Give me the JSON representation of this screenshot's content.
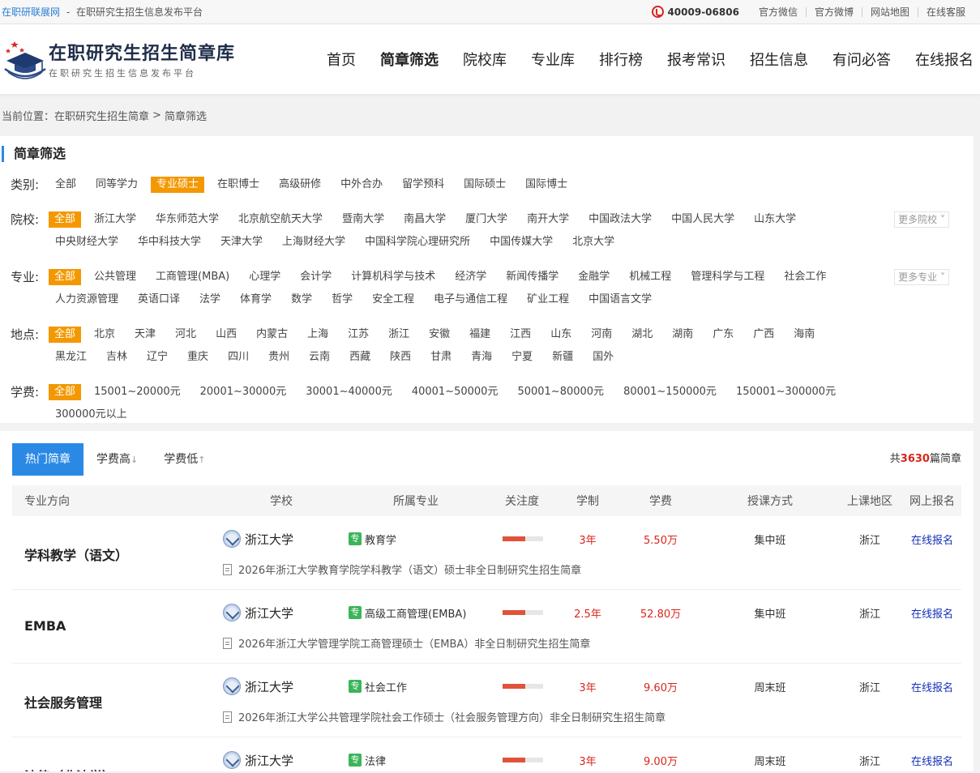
{
  "topbar": {
    "site_name": "在职研联展网",
    "separator": "-",
    "slogan": "在职研究生招生信息发布平台",
    "phone": "40009-06806",
    "links": [
      "官方微信",
      "官方微博",
      "网站地图",
      "在线客服"
    ]
  },
  "header": {
    "logo_title": "在职研究生招生简章库",
    "logo_subtitle": "在职研究生招生信息发布平台",
    "nav": [
      "首页",
      "简章筛选",
      "院校库",
      "专业库",
      "排行榜",
      "报考常识",
      "招生信息",
      "有问必答",
      "在线报名"
    ]
  },
  "breadcrumb": {
    "prefix": "当前位置：",
    "home": "在职研究生招生简章",
    "arrow": ">",
    "current": "简章筛选"
  },
  "filter": {
    "title": "简章筛选",
    "category": {
      "label": "类别:",
      "options": [
        "全部",
        "同等学力",
        "专业硕士",
        "在职博士",
        "高级研修",
        "中外合办",
        "留学预科",
        "国际硕士",
        "国际博士"
      ],
      "selected": 2
    },
    "school": {
      "label": "院校:",
      "options": [
        "全部",
        "浙江大学",
        "华东师范大学",
        "北京航空航天大学",
        "暨南大学",
        "南昌大学",
        "厦门大学",
        "南开大学",
        "中国政法大学",
        "中国人民大学",
        "山东大学",
        "中央财经大学",
        "华中科技大学",
        "天津大学",
        "上海财经大学",
        "中国科学院心理研究所",
        "中国传媒大学",
        "北京大学"
      ],
      "selected": 0,
      "more": "更多院校"
    },
    "major": {
      "label": "专业:",
      "options": [
        "全部",
        "公共管理",
        "工商管理(MBA)",
        "心理学",
        "会计学",
        "计算机科学与技术",
        "经济学",
        "新闻传播学",
        "金融学",
        "机械工程",
        "管理科学与工程",
        "社会工作",
        "人力资源管理",
        "英语口译",
        "法学",
        "体育学",
        "数学",
        "哲学",
        "安全工程",
        "电子与通信工程",
        "矿业工程",
        "中国语言文学"
      ],
      "selected": 0,
      "more": "更多专业"
    },
    "location": {
      "label": "地点:",
      "options": [
        "全部",
        "北京",
        "天津",
        "河北",
        "山西",
        "内蒙古",
        "上海",
        "江苏",
        "浙江",
        "安徽",
        "福建",
        "江西",
        "山东",
        "河南",
        "湖北",
        "湖南",
        "广东",
        "广西",
        "海南",
        "黑龙江",
        "吉林",
        "辽宁",
        "重庆",
        "四川",
        "贵州",
        "云南",
        "西藏",
        "陕西",
        "甘肃",
        "青海",
        "宁夏",
        "新疆",
        "国外"
      ],
      "selected": 0
    },
    "fee": {
      "label": "学费:",
      "options": [
        "全部",
        "15001~20000元",
        "20001~30000元",
        "30001~40000元",
        "40001~50000元",
        "50001~80000元",
        "80001~150000元",
        "150001~300000元",
        "300000元以上"
      ],
      "selected": 0
    }
  },
  "list": {
    "tabs": [
      "热门简章",
      "学费高",
      "学费低"
    ],
    "tab_arrows": [
      "↓",
      "↑"
    ],
    "total_prefix": "共",
    "total_count": "3630",
    "total_suffix": "篇简章",
    "headers": [
      "专业方向",
      "学校",
      "所属专业",
      "关注度",
      "学制",
      "学费",
      "授课方式",
      "上课地区",
      "网上报名"
    ],
    "zhuan_badge": "专",
    "rows": [
      {
        "direction": "学科教学（语文）",
        "school": "浙江大学",
        "major": "教育学",
        "attention": 0.55,
        "duration": "3年",
        "fee": "5.50万",
        "mode": "集中班",
        "area": "浙江",
        "register": "在线报名",
        "brochure": "2026年浙江大学教育学院学科教学（语文）硕士非全日制研究生招生简章"
      },
      {
        "direction": "EMBA",
        "school": "浙江大学",
        "major": "高级工商管理(EMBA)",
        "attention": 0.55,
        "duration": "2.5年",
        "fee": "52.80万",
        "mode": "集中班",
        "area": "浙江",
        "register": "在线报名",
        "brochure": "2026年浙江大学管理学院工商管理硕士（EMBA）非全日制研究生招生简章"
      },
      {
        "direction": "社会服务管理",
        "school": "浙江大学",
        "major": "社会工作",
        "attention": 0.55,
        "duration": "3年",
        "fee": "9.60万",
        "mode": "周末班",
        "area": "浙江",
        "register": "在线报名",
        "brochure": "2026年浙江大学公共管理学院社会工作硕士（社会服务管理方向）非全日制研究生招生简章"
      },
      {
        "direction": "法律（非法学）",
        "school": "浙江大学",
        "major": "法律",
        "attention": 0.55,
        "duration": "3年",
        "fee": "9.00万",
        "mode": "周末班",
        "area": "浙江",
        "register": "在线报名",
        "brochure": ""
      }
    ]
  }
}
